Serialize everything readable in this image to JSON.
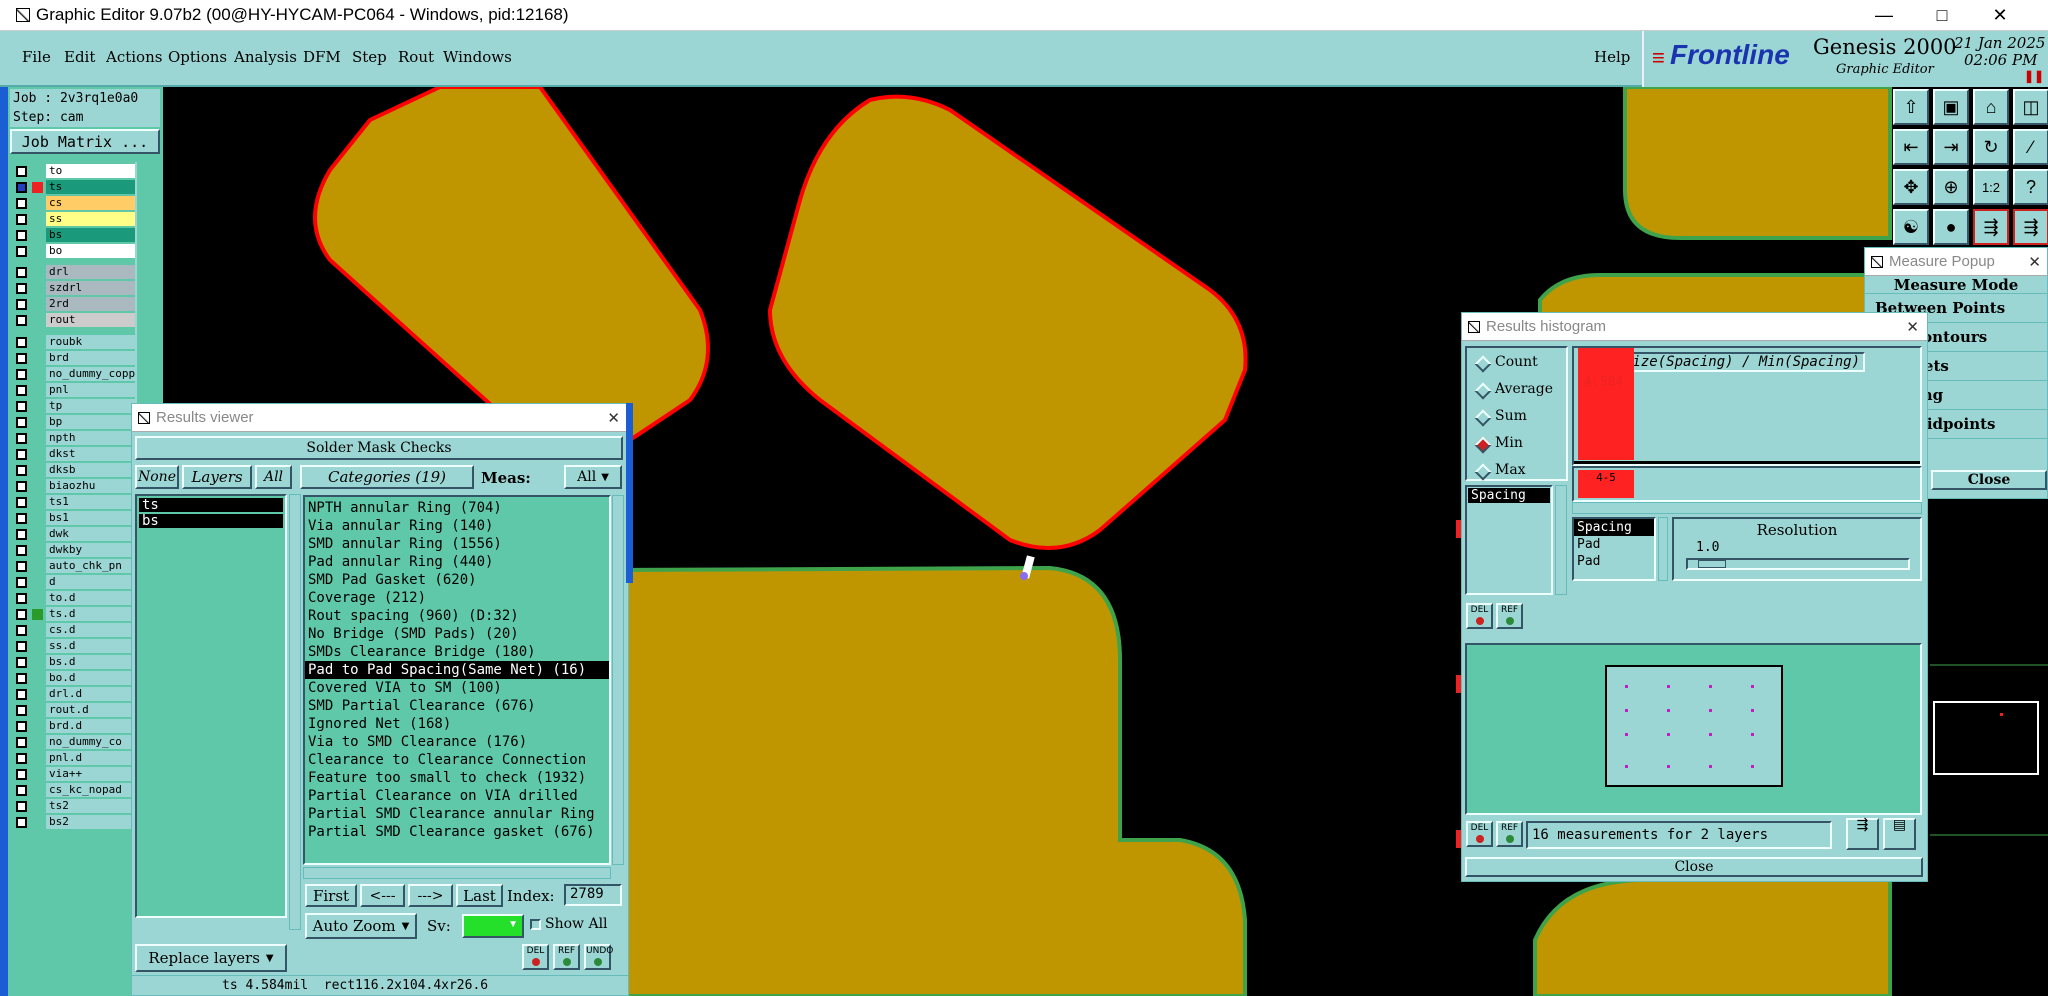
{
  "window": {
    "title": "Graphic Editor 9.07b2 (00@HY-HYCAM-PC064 - Windows, pid:12168)"
  },
  "menu": {
    "file": "File",
    "edit": "Edit",
    "actions": "Actions",
    "options": "Options",
    "analysis": "Analysis",
    "dfm": "DFM",
    "step": "Step",
    "rout": "Rout",
    "windows": "Windows",
    "help": "Help"
  },
  "logo": {
    "brand": "Frontline",
    "product": "Genesis 2000",
    "subtitle": "Graphic Editor",
    "date": "21 Jan 2025",
    "time": "02:06 PM"
  },
  "job": {
    "job_label": "Job : 2v3rq1e0a0",
    "step_label": "Step: cam",
    "matrix_button": "Job Matrix ..."
  },
  "layers": [
    {
      "name": "to",
      "color": "#ffffff"
    },
    {
      "name": "ts",
      "color": "#1a9a7a"
    },
    {
      "name": "cs",
      "color": "#ffcc66"
    },
    {
      "name": "ss",
      "color": "#ffff88"
    },
    {
      "name": "bs",
      "color": "#1a9a7a"
    },
    {
      "name": "bo",
      "color": "#ffffff"
    },
    {
      "name": "drl",
      "color": "#aab8bf"
    },
    {
      "name": "szdrl",
      "color": "#aab8bf"
    },
    {
      "name": "2rd",
      "color": "#aab8bf"
    },
    {
      "name": "rout",
      "color": "#cccccc"
    },
    {
      "name": "roubk",
      "color": "#9cd6d4"
    },
    {
      "name": "brd",
      "color": "#9cd6d4"
    },
    {
      "name": "no_dummy_copper",
      "color": "#9cd6d4"
    },
    {
      "name": "pnl",
      "color": "#9cd6d4"
    },
    {
      "name": "tp",
      "color": "#9cd6d4"
    },
    {
      "name": "bp",
      "color": "#9cd6d4"
    },
    {
      "name": "npth",
      "color": "#9cd6d4"
    },
    {
      "name": "dkst",
      "color": "#9cd6d4"
    },
    {
      "name": "dksb",
      "color": "#9cd6d4"
    },
    {
      "name": "biaozhu",
      "color": "#9cd6d4"
    },
    {
      "name": "ts1",
      "color": "#9cd6d4"
    },
    {
      "name": "bs1",
      "color": "#9cd6d4"
    },
    {
      "name": "dwk",
      "color": "#9cd6d4"
    },
    {
      "name": "dwkby",
      "color": "#9cd6d4"
    },
    {
      "name": "auto_chk_pn",
      "color": "#9cd6d4"
    },
    {
      "name": "d",
      "color": "#9cd6d4"
    },
    {
      "name": "to.d",
      "color": "#9cd6d4"
    },
    {
      "name": "ts.d",
      "color": "#9cd6d4"
    },
    {
      "name": "cs.d",
      "color": "#9cd6d4"
    },
    {
      "name": "ss.d",
      "color": "#9cd6d4"
    },
    {
      "name": "bs.d",
      "color": "#9cd6d4"
    },
    {
      "name": "bo.d",
      "color": "#9cd6d4"
    },
    {
      "name": "drl.d",
      "color": "#9cd6d4"
    },
    {
      "name": "rout.d",
      "color": "#9cd6d4"
    },
    {
      "name": "brd.d",
      "color": "#9cd6d4"
    },
    {
      "name": "no_dummy_co",
      "color": "#9cd6d4"
    },
    {
      "name": "pnl.d",
      "color": "#9cd6d4"
    },
    {
      "name": "via++",
      "color": "#9cd6d4"
    },
    {
      "name": "cs_kc_nopad",
      "color": "#9cd6d4"
    },
    {
      "name": "ts2",
      "color": "#9cd6d4"
    },
    {
      "name": "bs2",
      "color": "#9cd6d4"
    }
  ],
  "results_viewer": {
    "title": "Results viewer",
    "header": "Solder Mask Checks",
    "none_btn": "None",
    "layers_btn": "Layers",
    "all_btn": "All",
    "categories_btn": "Categories (19)",
    "meas_label": "Meas:",
    "meas_value": "All",
    "layer_items": [
      "ts",
      "bs"
    ],
    "categories": [
      "NPTH annular Ring (704)",
      "Via annular Ring (140)",
      "SMD annular Ring (1556)",
      "Pad annular Ring (440)",
      "SMD Pad Gasket (620)",
      "Coverage (212)",
      "Rout spacing (960)         (D:32)",
      "No Bridge (SMD Pads) (20)",
      "SMDs Clearance Bridge (180)",
      "Pad to Pad Spacing(Same Net) (16)",
      "Covered VIA to SM (100)",
      "SMD Partial Clearance (676)",
      "Ignored Net (168)",
      "Via to SMD Clearance (176)",
      "Clearance to Clearance Connection",
      "Feature too small to check (1932)",
      "Partial Clearance on VIA drilled",
      "Partial SMD Clearance annular Ring",
      "Partial SMD Clearance gasket (676)"
    ],
    "first": "First",
    "prev": "<---",
    "next": "--->",
    "last": "Last",
    "index_label": "Index:",
    "index_value": "2789",
    "autozoom": "Auto Zoom",
    "sv_label": "Sv:",
    "show_all": "Show All",
    "replace_layers": "Replace layers",
    "del": "DEL",
    "ref": "REF",
    "undo": "UNDO",
    "status": "ts 4.584mil  rect116.2x104.4xr26.6"
  },
  "histogram": {
    "title": "Results histogram",
    "graph_title": "Size(Spacing) / Min(Spacing)",
    "opt_count": "Count",
    "opt_average": "Average",
    "opt_sum": "Sum",
    "opt_min": "Min",
    "opt_max": "Max",
    "list_item": "Spacing",
    "bar_value": "4.584",
    "bar_value_fraction": 0.95,
    "bucket": "4-5",
    "resolution_label": "Resolution",
    "resolution_value": "1.0",
    "rows": [
      "Spacing",
      "Pad",
      "Pad"
    ],
    "measurements": "16 measurements for 2 layers",
    "close": "Close",
    "del": "DEL",
    "ref": "REF"
  },
  "measure_popup": {
    "title": "Measure Popup",
    "mode": "Measure Mode",
    "items": [
      "Between Points",
      "een Contours",
      "een Nets",
      "lar Ring",
      "een Midpoints"
    ],
    "close": "Close"
  },
  "colors": {
    "copper": "#bf9600",
    "red_outline": "#ff0000",
    "green_outline": "#3ea34a",
    "panel": "#9cd6d4",
    "panel_dark": "#5fc8a8"
  }
}
